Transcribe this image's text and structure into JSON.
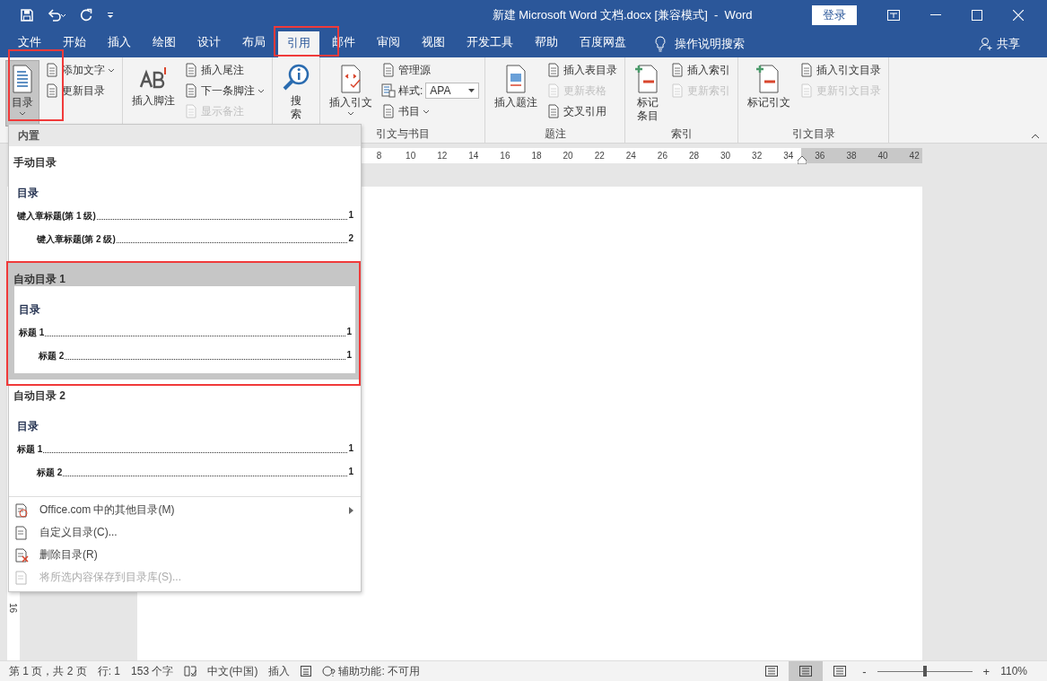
{
  "title_bar": {
    "title": "新建 Microsoft Word 文档.docx [兼容模式]  -  Word",
    "login_button": "登录"
  },
  "tabs": [
    {
      "label": "文件",
      "selected": false
    },
    {
      "label": "开始",
      "selected": false
    },
    {
      "label": "插入",
      "selected": false
    },
    {
      "label": "绘图",
      "selected": false
    },
    {
      "label": "设计",
      "selected": false
    },
    {
      "label": "布局",
      "selected": false
    },
    {
      "label": "引用",
      "selected": true
    },
    {
      "label": "邮件",
      "selected": false
    },
    {
      "label": "审阅",
      "selected": false
    },
    {
      "label": "视图",
      "selected": false
    },
    {
      "label": "开发工具",
      "selected": false
    },
    {
      "label": "帮助",
      "selected": false
    },
    {
      "label": "百度网盘",
      "selected": false
    }
  ],
  "tell_me": "操作说明搜索",
  "share": "共享",
  "ribbon": {
    "groups": [
      {
        "items": [
          {
            "kind": "big",
            "lines": [
              "目录"
            ],
            "dropdown": true,
            "pressed": true
          },
          {
            "kind": "small",
            "label": "添加文字",
            "dropdown": true,
            "disabled": false
          },
          {
            "kind": "small",
            "label": "更新目录",
            "dropdown": false,
            "disabled": false
          }
        ]
      },
      {
        "items": [
          {
            "kind": "big",
            "lines": [
              "插入脚注"
            ],
            "dropdown": false,
            "pressed": false
          },
          {
            "kind": "small",
            "label": "插入尾注",
            "dropdown": false,
            "disabled": false
          },
          {
            "kind": "small",
            "label": "下一条脚注",
            "dropdown": true,
            "disabled": false
          },
          {
            "kind": "small",
            "label": "显示备注",
            "dropdown": false,
            "disabled": true
          }
        ]
      },
      {
        "items": [
          {
            "kind": "big",
            "lines": [
              "搜",
              "索"
            ],
            "dropdown": false,
            "pressed": false
          }
        ]
      },
      {
        "label": "引文与书目",
        "items": [
          {
            "kind": "big",
            "lines": [
              "插入引文"
            ],
            "dropdown": true,
            "pressed": false
          },
          {
            "kind": "small",
            "label": "管理源",
            "dropdown": false,
            "disabled": false
          },
          {
            "kind": "select",
            "label": "样式:",
            "value": "APA"
          },
          {
            "kind": "small",
            "label": "书目",
            "dropdown": true,
            "disabled": false
          }
        ]
      },
      {
        "label": "题注",
        "items": [
          {
            "kind": "big",
            "lines": [
              "插入题注"
            ],
            "dropdown": false,
            "pressed": false
          },
          {
            "kind": "small",
            "label": "插入表目录",
            "dropdown": false,
            "disabled": false
          },
          {
            "kind": "small",
            "label": "更新表格",
            "dropdown": false,
            "disabled": true
          },
          {
            "kind": "small",
            "label": "交叉引用",
            "dropdown": false,
            "disabled": false
          }
        ]
      },
      {
        "label": "索引",
        "items": [
          {
            "kind": "big",
            "lines": [
              "标记",
              "条目"
            ],
            "dropdown": false,
            "pressed": false
          },
          {
            "kind": "small",
            "label": "插入索引",
            "dropdown": false,
            "disabled": false
          },
          {
            "kind": "small",
            "label": "更新索引",
            "dropdown": false,
            "disabled": true
          }
        ]
      },
      {
        "label": "引文目录",
        "items": [
          {
            "kind": "big",
            "lines": [
              "标记引文"
            ],
            "dropdown": false,
            "pressed": false
          },
          {
            "kind": "small",
            "label": "插入引文目录",
            "dropdown": false,
            "disabled": false
          },
          {
            "kind": "small",
            "label": "更新引文目录",
            "dropdown": false,
            "disabled": true
          }
        ]
      }
    ]
  },
  "ruler": {
    "labels": [
      "8",
      "10",
      "12",
      "14",
      "16",
      "18",
      "20",
      "22",
      "24",
      "26",
      "28",
      "30",
      "32",
      "34",
      "36",
      "38",
      "40",
      "42"
    ]
  },
  "vertical_ruler": {
    "labels": [
      "16"
    ]
  },
  "toc_menu": {
    "section": "内置",
    "gallery": [
      {
        "title": "手动目录",
        "selected": false,
        "heading": "目录",
        "entries": [
          {
            "text": "键入章标题(第 1 级)",
            "page": "1",
            "children": [
              {
                "text": "键入章标题(第 2 级)",
                "page": "2"
              }
            ]
          }
        ]
      },
      {
        "title": "自动目录 1",
        "selected": true,
        "heading": "目录",
        "entries": [
          {
            "text": "标题 1",
            "page": "1",
            "children": [
              {
                "text": "标题 2",
                "page": "1"
              }
            ]
          }
        ]
      },
      {
        "title": "自动目录 2",
        "selected": false,
        "heading": "目录",
        "entries": [
          {
            "text": "标题 1",
            "page": "1",
            "children": [
              {
                "text": "标题 2",
                "page": "1"
              }
            ]
          }
        ]
      }
    ],
    "commands": [
      {
        "label": "Office.com 中的其他目录(M)",
        "submenu": true,
        "disabled": false
      },
      {
        "label": "自定义目录(C)...",
        "submenu": false,
        "disabled": false
      },
      {
        "label": "删除目录(R)",
        "submenu": false,
        "disabled": false
      },
      {
        "label": "将所选内容保存到目录库(S)...",
        "submenu": false,
        "disabled": true
      }
    ]
  },
  "status_bar": {
    "page": "第 1 页，共 2 页",
    "line": "行: 1",
    "words": "153 个字",
    "language": "中文(中国)",
    "mode": "插入",
    "accessibility": "辅助功能: 不可用",
    "views": [
      {
        "selected": false
      },
      {
        "selected": true
      },
      {
        "selected": false
      }
    ],
    "zoom": {
      "minus": "-",
      "plus": "+",
      "level": 0.5,
      "percent": "110%"
    }
  }
}
